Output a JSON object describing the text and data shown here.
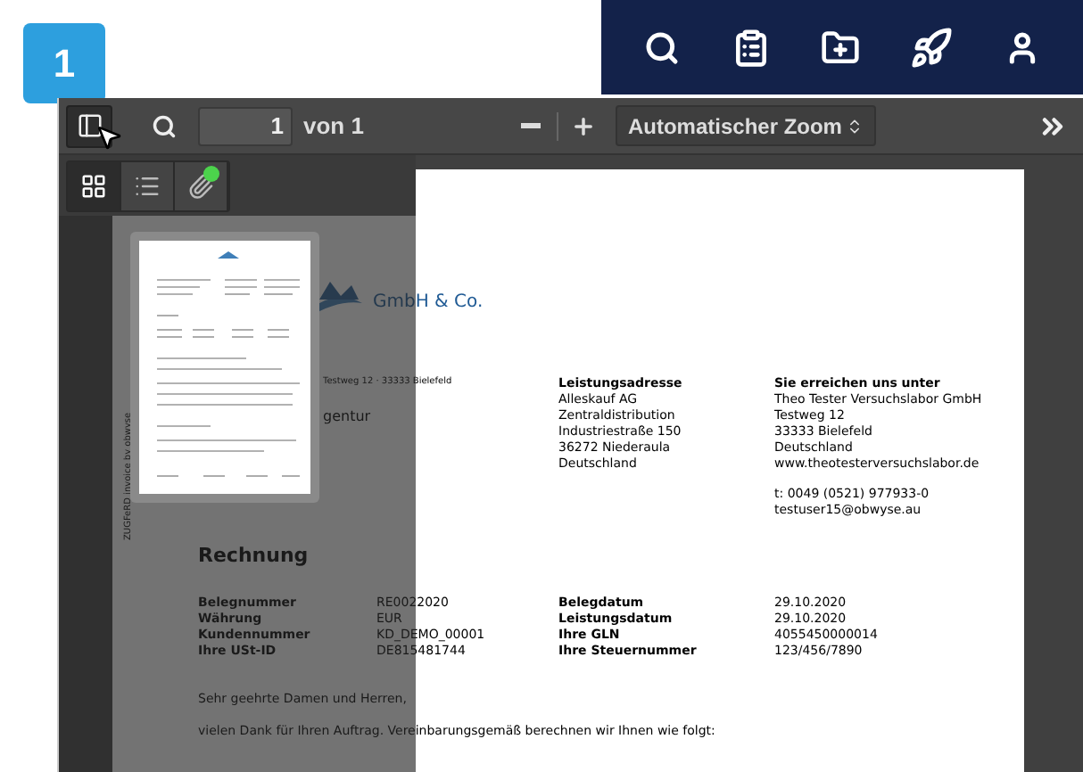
{
  "badge": {
    "label": "1"
  },
  "toolbar": {
    "sidebar_toggle": {
      "selected": true
    },
    "page_number": {
      "value": "1"
    },
    "page_count": "von 1",
    "zoom": {
      "value": "Automatischer Zoom"
    }
  },
  "sidebar": {
    "tabs": [
      {
        "kind": "thumbnails",
        "selected": true,
        "has_items": false
      },
      {
        "kind": "outline",
        "selected": false,
        "has_items": false
      },
      {
        "kind": "attachments",
        "selected": false,
        "has_items": true
      }
    ],
    "thumbnails": [
      {
        "selected": true
      }
    ]
  },
  "document": {
    "company_fragment": "GmbH & Co.",
    "sender_line": "Testweg 12 · 33333 Bielefeld",
    "address_fragment": "gentur",
    "side_note": "ZUGFeRD invoice by obwyse",
    "delivery_address": {
      "heading": "Leistungsadresse",
      "lines": [
        "Alleskauf AG",
        "Zentraldistribution",
        "Industriestraße 150",
        "36272 Niederaula",
        "Deutschland"
      ]
    },
    "contact": {
      "heading": "Sie erreichen uns unter",
      "lines": [
        "Theo Tester Versuchslabor GmbH",
        "Testweg 12",
        "33333 Bielefeld",
        "Deutschland",
        "www.theotesterversuchslabor.de"
      ],
      "extra_lines": [
        "t: 0049 (0521) 977933-0",
        "testuser15@obwyse.au"
      ]
    },
    "title": "Rechnung",
    "fields": [
      [
        {
          "label": "Belegnummer",
          "value": "RE0022020"
        },
        {
          "label": "Belegdatum",
          "value": "29.10.2020"
        }
      ],
      [
        {
          "label": "Währung",
          "value": "EUR"
        },
        {
          "label": "Leistungsdatum",
          "value": "29.10.2020"
        }
      ],
      [
        {
          "label": "Kundennummer",
          "value": "KD_DEMO_00001"
        },
        {
          "label": "Ihre GLN",
          "value": "4055450000014"
        }
      ],
      [
        {
          "label": "Ihre USt-ID",
          "value": "DE815481744"
        },
        {
          "label": "Ihre Steuernummer",
          "value": "123/456/7890"
        }
      ]
    ],
    "salutation": "Sehr geehrte Damen und Herren,",
    "intro": "vielen Dank für Ihren Auftrag. Vereinbarungsgemäß berechnen wir Ihnen wie folgt:"
  }
}
